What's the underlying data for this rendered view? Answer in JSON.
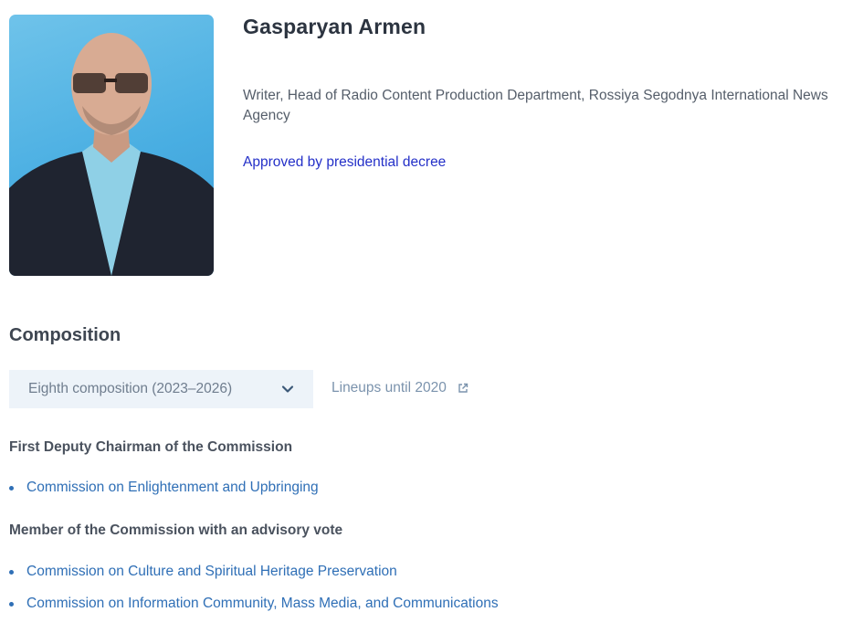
{
  "profile": {
    "name": "Gasparyan Armen",
    "position": "Writer, Head of Radio Content Production Department, Rossiya Segodnya International News Agency",
    "approval": "Approved by presidential decree"
  },
  "composition": {
    "title": "Composition",
    "selected": "Eighth composition (2023–2026)",
    "lineups_link": "Lineups until 2020",
    "groups": [
      {
        "role": "First Deputy Chairman of the Commission",
        "items": [
          "Commission on Enlightenment and Upbringing"
        ]
      },
      {
        "role": "Member of the Commission with an advisory vote",
        "items": [
          "Commission on Culture and Spiritual Heritage Preservation",
          "Commission on Information Community, Mass Media, and Communications"
        ]
      }
    ]
  },
  "colors": {
    "link": "#2f6fb6",
    "approval_link": "#2430c8",
    "dropdown_bg": "#edf3f9",
    "photo_bg": "#49aee2"
  },
  "icons": {
    "dropdown": "chevron-down-icon",
    "external": "external-link-icon"
  }
}
